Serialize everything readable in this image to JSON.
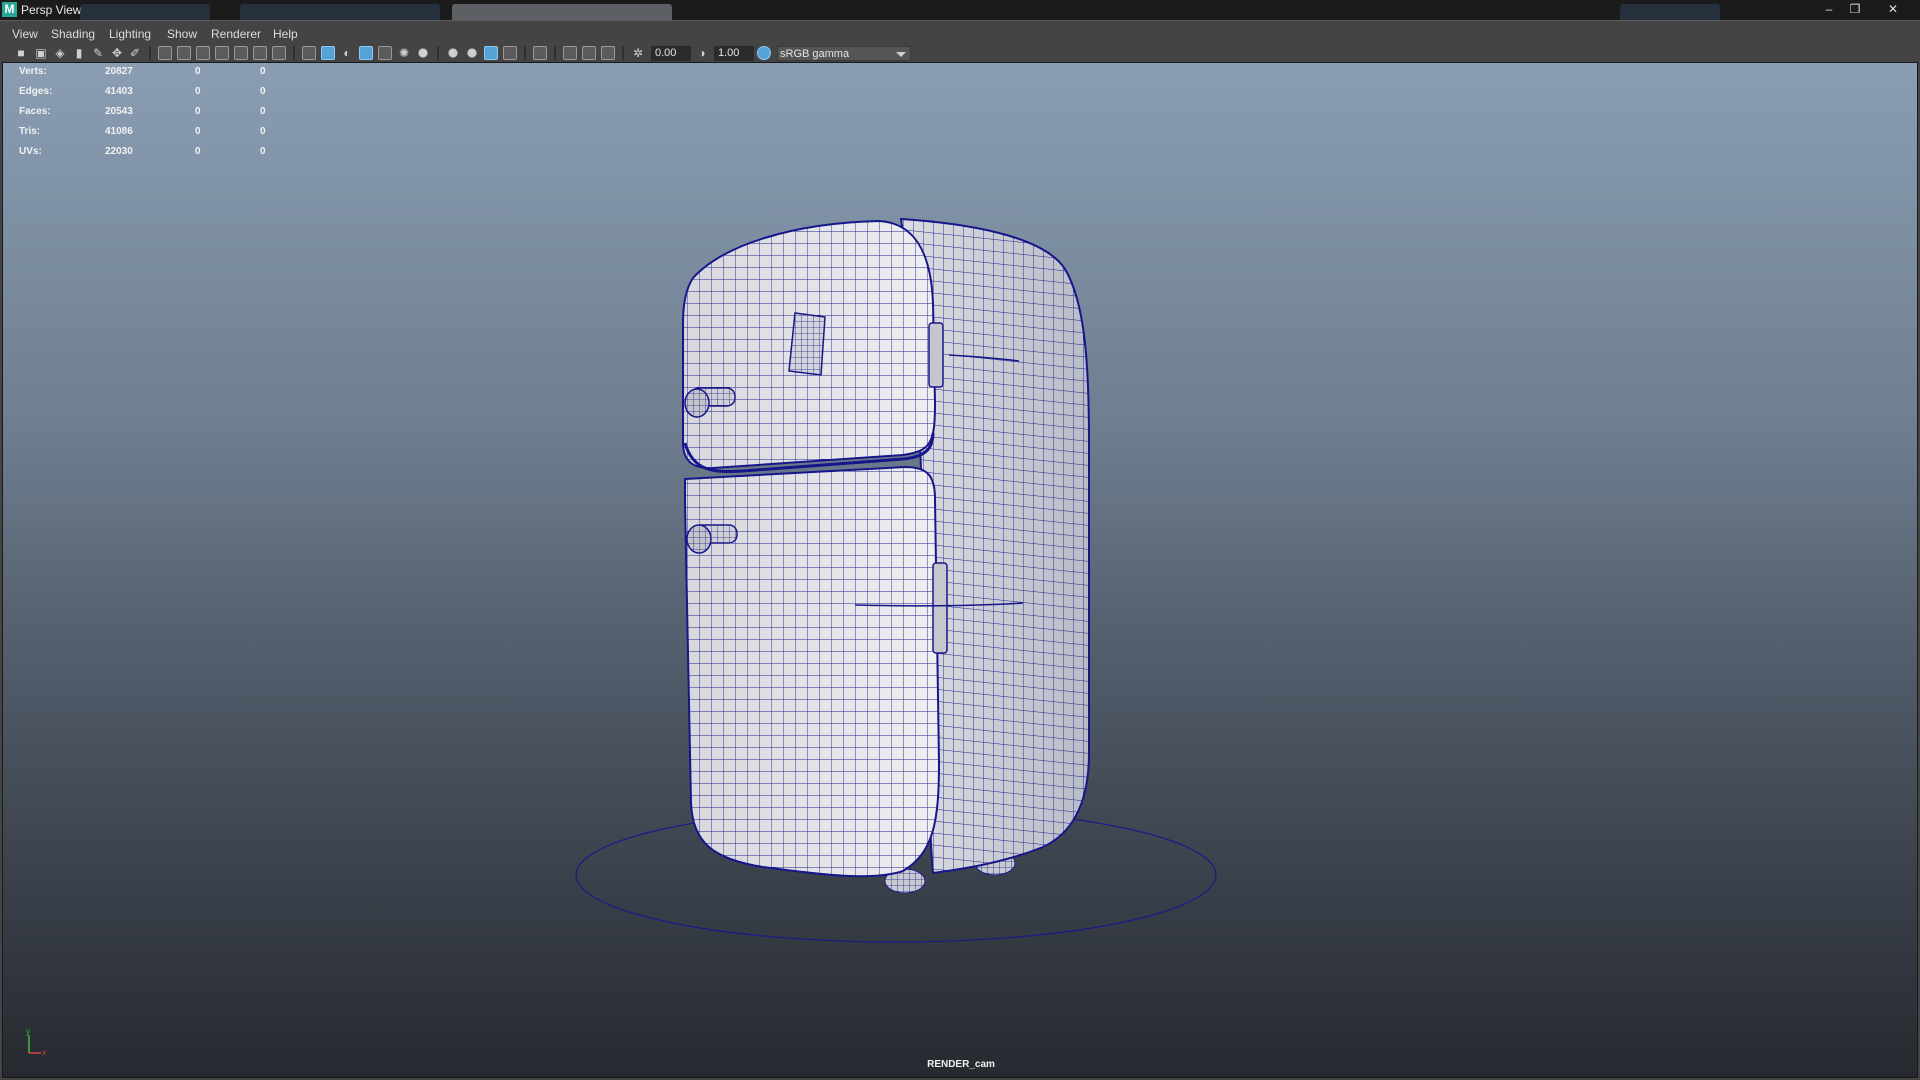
{
  "window": {
    "title": "Persp View",
    "app_icon_letter": "M",
    "controls": {
      "minimize": "–",
      "restore": "❐",
      "close": "✕"
    }
  },
  "menubar": {
    "items": [
      "View",
      "Shading",
      "Lighting",
      "Show",
      "Renderer",
      "Help"
    ]
  },
  "toolbar": {
    "exposure_value": "0.00",
    "gamma_value": "1.00",
    "color_space": "sRGB gamma"
  },
  "hud": {
    "rows": [
      {
        "label": "Verts:",
        "total": "20827",
        "selected": "0",
        "extra": "0"
      },
      {
        "label": "Edges:",
        "total": "41403",
        "selected": "0",
        "extra": "0"
      },
      {
        "label": "Faces:",
        "total": "20543",
        "selected": "0",
        "extra": "0"
      },
      {
        "label": "Tris:",
        "total": "41086",
        "selected": "0",
        "extra": "0"
      },
      {
        "label": "UVs:",
        "total": "22030",
        "selected": "0",
        "extra": "0"
      }
    ]
  },
  "viewport": {
    "camera_name": "RENDER_cam",
    "axis": {
      "y_label": "y",
      "x_label": "x",
      "y_color": "#3fbf3f",
      "x_color": "#e04040"
    },
    "background_top": "#8a9db3",
    "background_bottom": "#26292f",
    "wire_color": "#14148a",
    "object": "fridge-model"
  }
}
